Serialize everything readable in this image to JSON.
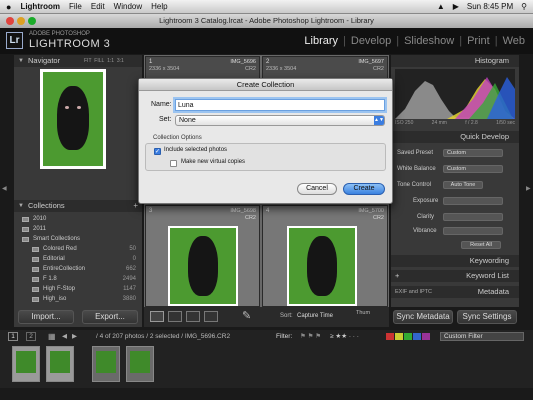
{
  "menubar": {
    "apple": "",
    "app": "Lightroom",
    "items": [
      "File",
      "Edit",
      "Window",
      "Help"
    ],
    "clock": "Sun 8:45 PM"
  },
  "window": {
    "title": "Lightroom 3 Catalog.lrcat - Adobe Photoshop Lightroom - Library"
  },
  "brand": {
    "badge": "Lr",
    "line1": "ADOBE PHOTOSHOP",
    "line2": "LIGHTROOM 3"
  },
  "modules": {
    "library": "Library",
    "develop": "Develop",
    "slideshow": "Slideshow",
    "print": "Print",
    "web": "Web",
    "sep": "|"
  },
  "navigator": {
    "title": "Navigator",
    "zoom": [
      "FIT",
      "FILL",
      "1:1",
      "3:1"
    ]
  },
  "collections": {
    "title": "Collections",
    "add": "+",
    "items": [
      {
        "name": "2010",
        "count": ""
      },
      {
        "name": "2011",
        "count": ""
      },
      {
        "name": "Smart Collections",
        "count": ""
      },
      {
        "name": "Colored Red",
        "count": "50"
      },
      {
        "name": "Editorial",
        "count": "0"
      },
      {
        "name": "EntireCollection",
        "count": "662"
      },
      {
        "name": "F 1.8",
        "count": "2494"
      },
      {
        "name": "High F-Stop",
        "count": "1147"
      },
      {
        "name": "High_iso",
        "count": "3880"
      }
    ]
  },
  "left_buttons": {
    "import": "Import...",
    "export": "Export..."
  },
  "grid": {
    "cells": [
      {
        "index": "1",
        "dims": "2336 x 3504",
        "file": "IMG_5696",
        "ext": "CR2"
      },
      {
        "index": "2",
        "dims": "2336 x 3504",
        "file": "IMG_5697",
        "ext": "CR2"
      },
      {
        "index": "3",
        "dims": "",
        "file": "IMG_5698",
        "ext": "CR2"
      },
      {
        "index": "4",
        "dims": "",
        "file": "IMG_5700",
        "ext": "CR2"
      }
    ]
  },
  "toolbar": {
    "sort_label": "Sort:",
    "sort_value": "Capture Time",
    "thumbs": "Thum"
  },
  "histogram": {
    "title": "Histogram",
    "iso": "ISO 250",
    "focal": "24 mm",
    "aperture": "f / 2.8",
    "shutter": "1/50 sec"
  },
  "quick_develop": {
    "title": "Quick Develop",
    "saved_preset_label": "Saved Preset",
    "saved_preset_value": "Custom",
    "white_balance_label": "White Balance",
    "white_balance_value": "Custom",
    "tone_control_label": "Tone Control",
    "auto_tone": "Auto Tone",
    "exposure": "Exposure",
    "clarity": "Clarity",
    "vibrance": "Vibrance",
    "reset_all": "Reset All"
  },
  "keywording": {
    "title": "Keywording"
  },
  "keyword_list": {
    "title": "Keyword List",
    "add": "+"
  },
  "metadata": {
    "title": "Metadata",
    "preset": "EXIF and IPTC"
  },
  "right_buttons": {
    "sync_metadata": "Sync Metadata",
    "sync_settings": "Sync Settings"
  },
  "filmstrip_bar": {
    "page1": "1",
    "page2": "2",
    "status": "/ 4 of 207 photos / 2 selected / IMG_5696.CR2",
    "filter_label": "Filter:",
    "filter_value": "Custom Filter"
  },
  "dialog": {
    "title": "Create Collection",
    "name_label": "Name:",
    "name_value": "Luna",
    "set_label": "Set:",
    "set_value": "None",
    "options_label": "Collection Options",
    "include_selected": "Include selected photos",
    "include_selected_checked": true,
    "make_virtual": "Make new virtual copies",
    "make_virtual_checked": false,
    "cancel": "Cancel",
    "create": "Create"
  },
  "colors": {
    "accent": "#3b7de0",
    "panel": "#393939",
    "background": "#1a1a1a"
  }
}
